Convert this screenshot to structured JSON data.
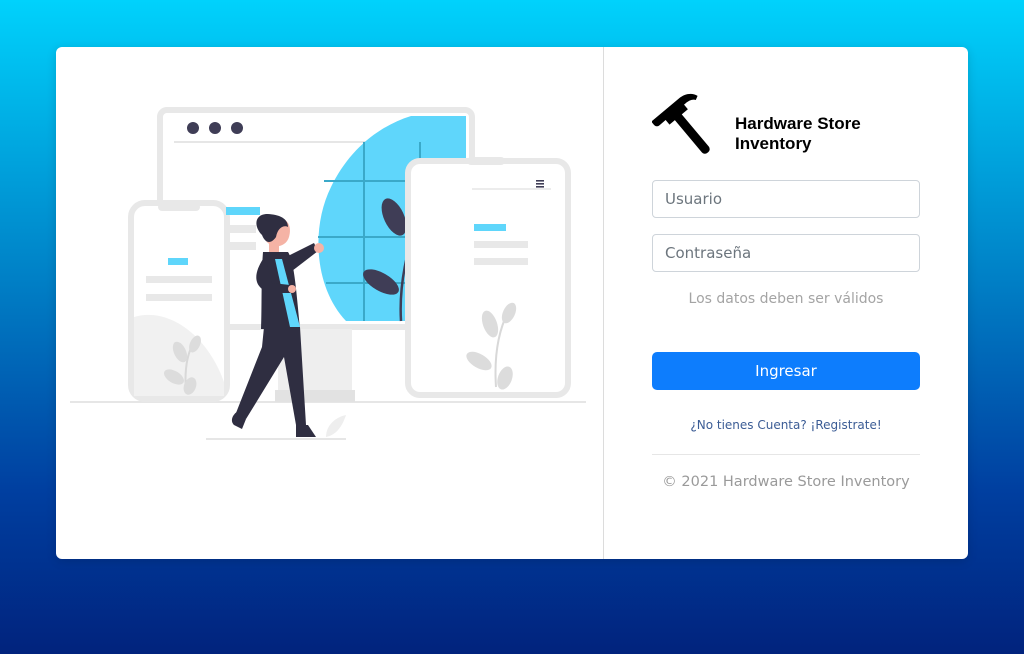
{
  "brand": {
    "logo_icon": "hammer-icon",
    "title_line1": "Hardware Store",
    "title_line2": "Inventory"
  },
  "illustration": {
    "icon": "woman-presenting-devices-illustration",
    "accent_color": "#5fd6fb"
  },
  "form": {
    "username_placeholder": "Usuario",
    "username_value": "",
    "password_placeholder": "Contraseña",
    "password_value": "",
    "validation_hint": "Los datos deben ser válidos",
    "submit_label": "Ingresar",
    "register_link": "¿No tienes Cuenta? ¡Registrate!"
  },
  "footer": {
    "copyright": "© 2021 Hardware Store Inventory"
  },
  "colors": {
    "primary_button": "#0d7dfd",
    "link": "#3b5c95",
    "background_top": "#00d2fc",
    "background_bottom": "#01237d"
  }
}
